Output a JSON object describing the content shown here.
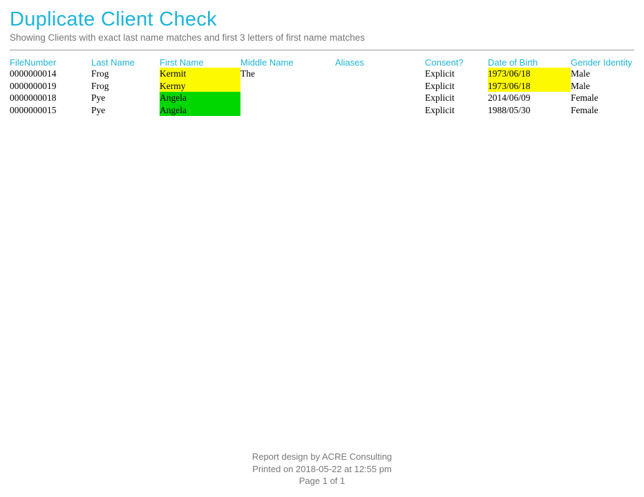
{
  "header": {
    "title": "Duplicate Client Check",
    "subtitle": "Showing Clients with exact last name matches and first 3 letters of first name matches"
  },
  "colors": {
    "accent": "#1db3d8",
    "highlight_group_a": "#fcf900",
    "highlight_group_b": "#00d700"
  },
  "table": {
    "headers": {
      "file_number": "FileNumber",
      "last_name": "Last Name",
      "first_name": "First Name",
      "middle_name": "Middle Name",
      "aliases": "Aliases",
      "consent": "Consent?",
      "dob": "Date of Birth",
      "gender": "Gender Identity"
    },
    "rows": [
      {
        "file_number": "0000000014",
        "last_name": "Frog",
        "first_name": "Kermit",
        "first_name_hl": "yellow",
        "middle_name": "The",
        "aliases": "",
        "consent": "Explicit",
        "dob": "1973/06/18",
        "dob_hl": "yellow",
        "gender": "Male"
      },
      {
        "file_number": "0000000019",
        "last_name": "Frog",
        "first_name": "Kermy",
        "first_name_hl": "yellow",
        "middle_name": "",
        "aliases": "",
        "consent": "Explicit",
        "dob": "1973/06/18",
        "dob_hl": "yellow",
        "gender": "Male"
      },
      {
        "file_number": "0000000018",
        "last_name": "Pye",
        "first_name": "Angela",
        "first_name_hl": "green",
        "middle_name": "",
        "aliases": "",
        "consent": "Explicit",
        "dob": "2014/06/09",
        "dob_hl": "",
        "gender": "Female"
      },
      {
        "file_number": "0000000015",
        "last_name": "Pye",
        "first_name": "Angela",
        "first_name_hl": "green",
        "middle_name": "",
        "aliases": "",
        "consent": "Explicit",
        "dob": "1988/05/30",
        "dob_hl": "",
        "gender": "Female"
      }
    ]
  },
  "footer": {
    "design": "Report design by ACRE Consulting",
    "printed": "Printed on 2018-05-22 at 12:55 pm",
    "page": "Page 1 of 1"
  }
}
